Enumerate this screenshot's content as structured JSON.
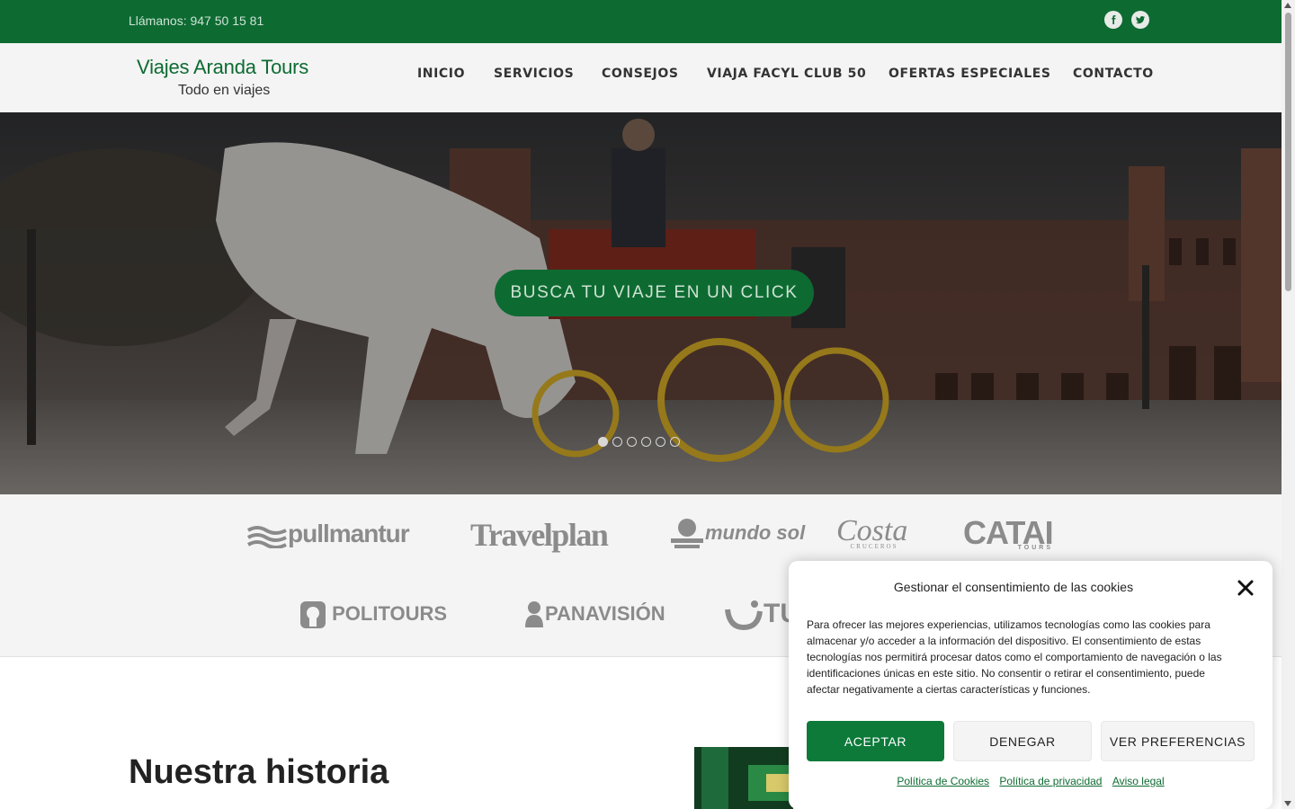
{
  "topbar": {
    "phone": "Llámanos: 947 50 15 81",
    "social": [
      "facebook-icon",
      "twitter-icon"
    ],
    "color": "#0d6b32"
  },
  "header": {
    "title": "Viajes Aranda Tours",
    "tagline": "Todo en viajes",
    "nav": [
      "INICIO",
      "SERVICIOS",
      "CONSEJOS",
      "VIAJA FACYL CLUB 50",
      "OFERTAS ESPECIALES",
      "CONTACTO"
    ]
  },
  "hero": {
    "button": "BUSCA TU VIAJE EN UN CLICK",
    "slides_total": 6,
    "active_slide": 1
  },
  "partners": {
    "row1": [
      "pullmantur",
      "Travelplan",
      "mundo sol",
      "Costa",
      "CATAI"
    ],
    "costa_sub": "CRUCEROS",
    "catai_sub": "TOURS",
    "row2": [
      "POLITOURS",
      "PANAVISIÓN",
      "TU"
    ]
  },
  "story": {
    "title": "Nuestra historia"
  },
  "cookie": {
    "title": "Gestionar el consentimiento de las cookies",
    "text": "Para ofrecer las mejores experiencias, utilizamos tecnologías como las cookies para almacenar y/o acceder a la información del dispositivo. El consentimiento de estas tecnologías nos permitirá procesar datos como el comportamiento de navegación o las identificaciones únicas en este sitio. No consentir o retirar el consentimiento, puede afectar negativamente a ciertas características y funciones.",
    "accept": "ACEPTAR",
    "deny": "DENEGAR",
    "preferences": "VER PREFERENCIAS",
    "links": [
      "Política de Cookies",
      "Política de privacidad",
      "Aviso legal"
    ]
  }
}
